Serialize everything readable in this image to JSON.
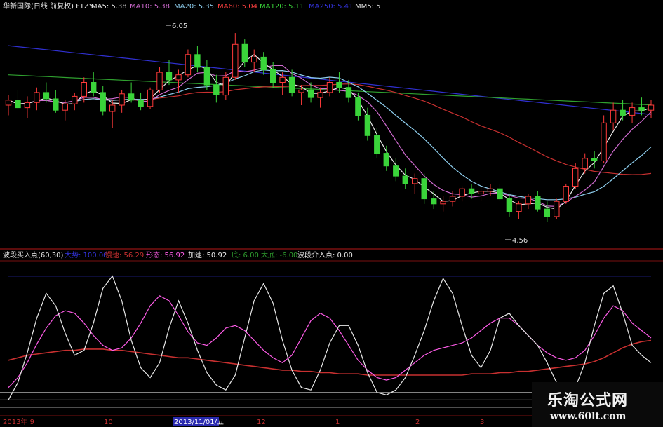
{
  "colors": {
    "up": "#ff3a3a",
    "down": "#3ad43a",
    "ma5": "#e8e8e8",
    "ma10": "#d06bd0",
    "ma20": "#8fd0f0",
    "ma60": "#c83030",
    "ma120": "#2fa02f",
    "ma250": "#3030d0",
    "mm5": "#e8e8e8",
    "big": "#3434e0",
    "slow": "#c83030",
    "shape": "#ff5ce8",
    "accel": "#e8e8e8",
    "rise": "#2fa02f",
    "divider": "#7a1010"
  },
  "price_header": {
    "stock": "华新国际(日线 前复权) FTZY",
    "ma5_label": "MA5: 5.38",
    "ma10_label": "MA10: 5.38",
    "ma20_label": "MA20: 5.35",
    "ma60_label": "MA60: 5.04",
    "ma120_label": "MA120: 5.11",
    "ma250_label": "MA250: 5.41",
    "mm5_label": "MM5: 5"
  },
  "price_annotations": {
    "high": "6.05",
    "low": "4.56"
  },
  "indicator_header": {
    "name": "波段买入点(60,30)",
    "big_label": "大势: 100.00",
    "slow_label": "慢速: 56.29",
    "shape_label": "形态: 56.92",
    "accel_label": "加速: 50.92",
    "rise_label": "底: 6.00",
    "rise2_label": "大底: -6.00",
    "entry_label": "波段介入点: 0.00"
  },
  "time_axis": {
    "labels": [
      "2013年 9",
      "10",
      "2013/11/01/五",
      "12",
      "1",
      "2",
      "3"
    ],
    "highlight": "2013/11/01/五"
  },
  "watermark": {
    "cn": "乐淘公式网",
    "url": "www.60lt.com"
  },
  "chart_data": {
    "type": "candlestick",
    "price_range": [
      4.4,
      6.2
    ],
    "high": 6.05,
    "low": 4.56,
    "candles": [
      [
        5.48,
        5.56,
        5.4,
        5.52
      ],
      [
        5.52,
        5.6,
        5.45,
        5.46
      ],
      [
        5.46,
        5.55,
        5.38,
        5.5
      ],
      [
        5.5,
        5.62,
        5.44,
        5.58
      ],
      [
        5.58,
        5.66,
        5.5,
        5.53
      ],
      [
        5.53,
        5.6,
        5.42,
        5.44
      ],
      [
        5.44,
        5.52,
        5.36,
        5.49
      ],
      [
        5.49,
        5.58,
        5.44,
        5.55
      ],
      [
        5.55,
        5.7,
        5.5,
        5.66
      ],
      [
        5.66,
        5.74,
        5.55,
        5.58
      ],
      [
        5.58,
        5.63,
        5.4,
        5.43
      ],
      [
        5.43,
        5.52,
        5.3,
        5.48
      ],
      [
        5.48,
        5.6,
        5.42,
        5.57
      ],
      [
        5.57,
        5.66,
        5.5,
        5.52
      ],
      [
        5.52,
        5.58,
        5.44,
        5.47
      ],
      [
        5.47,
        5.62,
        5.45,
        5.6
      ],
      [
        5.6,
        5.78,
        5.58,
        5.74
      ],
      [
        5.74,
        5.84,
        5.64,
        5.68
      ],
      [
        5.68,
        5.76,
        5.58,
        5.72
      ],
      [
        5.72,
        5.92,
        5.7,
        5.88
      ],
      [
        5.88,
        5.95,
        5.74,
        5.78
      ],
      [
        5.78,
        5.84,
        5.6,
        5.64
      ],
      [
        5.64,
        5.72,
        5.5,
        5.56
      ],
      [
        5.56,
        5.74,
        5.52,
        5.7
      ],
      [
        5.7,
        6.05,
        5.68,
        5.96
      ],
      [
        5.96,
        6.0,
        5.78,
        5.82
      ],
      [
        5.82,
        5.92,
        5.74,
        5.86
      ],
      [
        5.86,
        5.9,
        5.72,
        5.76
      ],
      [
        5.76,
        5.82,
        5.62,
        5.66
      ],
      [
        5.66,
        5.74,
        5.56,
        5.7
      ],
      [
        5.7,
        5.76,
        5.55,
        5.58
      ],
      [
        5.58,
        5.64,
        5.48,
        5.6
      ],
      [
        5.6,
        5.66,
        5.5,
        5.54
      ],
      [
        5.54,
        5.62,
        5.46,
        5.58
      ],
      [
        5.58,
        5.7,
        5.55,
        5.66
      ],
      [
        5.66,
        5.74,
        5.58,
        5.62
      ],
      [
        5.62,
        5.68,
        5.5,
        5.54
      ],
      [
        5.54,
        5.58,
        5.36,
        5.4
      ],
      [
        5.4,
        5.46,
        5.2,
        5.24
      ],
      [
        5.24,
        5.3,
        5.06,
        5.1
      ],
      [
        5.1,
        5.16,
        4.96,
        5.0
      ],
      [
        5.0,
        5.06,
        4.88,
        4.92
      ],
      [
        4.92,
        4.98,
        4.82,
        4.86
      ],
      [
        4.86,
        4.94,
        4.78,
        4.9
      ],
      [
        4.9,
        4.94,
        4.7,
        4.74
      ],
      [
        4.74,
        4.8,
        4.66,
        4.7
      ],
      [
        4.7,
        4.76,
        4.64,
        4.72
      ],
      [
        4.72,
        4.8,
        4.68,
        4.76
      ],
      [
        4.76,
        4.84,
        4.72,
        4.82
      ],
      [
        4.82,
        4.86,
        4.74,
        4.78
      ],
      [
        4.78,
        4.84,
        4.72,
        4.8
      ],
      [
        4.8,
        4.86,
        4.76,
        4.82
      ],
      [
        4.82,
        4.86,
        4.72,
        4.74
      ],
      [
        4.74,
        4.78,
        4.6,
        4.64
      ],
      [
        4.64,
        4.72,
        4.58,
        4.7
      ],
      [
        4.7,
        4.78,
        4.66,
        4.76
      ],
      [
        4.76,
        4.8,
        4.64,
        4.66
      ],
      [
        4.66,
        4.72,
        4.56,
        4.6
      ],
      [
        4.6,
        4.74,
        4.58,
        4.72
      ],
      [
        4.72,
        4.86,
        4.7,
        4.84
      ],
      [
        4.84,
        5.02,
        4.82,
        4.98
      ],
      [
        4.98,
        5.1,
        4.94,
        5.06
      ],
      [
        5.06,
        5.12,
        4.98,
        5.04
      ],
      [
        5.04,
        5.4,
        5.02,
        5.34
      ],
      [
        5.34,
        5.5,
        5.28,
        5.44
      ],
      [
        5.44,
        5.52,
        5.36,
        5.4
      ],
      [
        5.4,
        5.5,
        5.34,
        5.46
      ],
      [
        5.46,
        5.54,
        5.4,
        5.44
      ],
      [
        5.44,
        5.52,
        5.38,
        5.48
      ]
    ],
    "oscillator": {
      "range": [
        -10,
        110
      ],
      "series": [
        {
          "name": "大势",
          "values": [
            100,
            100,
            100,
            100,
            100,
            100,
            100,
            100,
            100,
            100,
            100,
            100,
            100,
            100,
            100,
            100,
            100,
            100,
            100,
            100,
            100,
            100,
            100,
            100,
            100,
            100,
            100,
            100,
            100,
            100,
            100,
            100,
            100,
            100,
            100,
            100,
            100,
            100,
            100,
            100,
            100,
            100,
            100,
            100,
            100,
            100,
            100,
            100,
            100,
            100,
            100,
            100,
            100,
            100,
            100,
            100,
            100,
            100,
            100,
            100,
            100,
            100,
            100,
            100,
            100,
            100,
            100,
            100,
            100
          ]
        },
        {
          "name": "慢速",
          "values": [
            32,
            34,
            36,
            37,
            38,
            39,
            40,
            40,
            41,
            41,
            41,
            40,
            40,
            39,
            38,
            37,
            36,
            35,
            34,
            34,
            33,
            32,
            31,
            30,
            29,
            28,
            27,
            26,
            25,
            24,
            24,
            23,
            23,
            22,
            22,
            21,
            21,
            21,
            20,
            20,
            20,
            20,
            20,
            20,
            20,
            20,
            20,
            20,
            20,
            21,
            21,
            21,
            22,
            22,
            23,
            23,
            24,
            25,
            26,
            27,
            28,
            29,
            31,
            34,
            38,
            42,
            45,
            47,
            48
          ]
        },
        {
          "name": "形态",
          "values": [
            10,
            18,
            30,
            45,
            58,
            68,
            72,
            70,
            62,
            52,
            44,
            40,
            42,
            50,
            62,
            76,
            84,
            80,
            68,
            55,
            46,
            44,
            50,
            58,
            60,
            56,
            48,
            40,
            34,
            30,
            36,
            50,
            64,
            70,
            66,
            56,
            44,
            32,
            24,
            18,
            16,
            18,
            24,
            30,
            36,
            40,
            42,
            44,
            46,
            50,
            56,
            62,
            66,
            66,
            60,
            52,
            44,
            38,
            34,
            32,
            34,
            40,
            52,
            66,
            76,
            72,
            62,
            56,
            50
          ]
        },
        {
          "name": "加速",
          "values": [
            0,
            14,
            38,
            66,
            86,
            76,
            54,
            36,
            40,
            62,
            90,
            100,
            80,
            48,
            26,
            18,
            30,
            58,
            80,
            62,
            40,
            22,
            12,
            8,
            20,
            50,
            80,
            94,
            78,
            48,
            24,
            10,
            8,
            24,
            46,
            60,
            60,
            44,
            22,
            6,
            4,
            8,
            18,
            36,
            56,
            80,
            98,
            86,
            60,
            36,
            26,
            40,
            66,
            70,
            60,
            52,
            44,
            30,
            14,
            6,
            10,
            30,
            60,
            86,
            92,
            70,
            44,
            36,
            30
          ]
        }
      ]
    }
  }
}
